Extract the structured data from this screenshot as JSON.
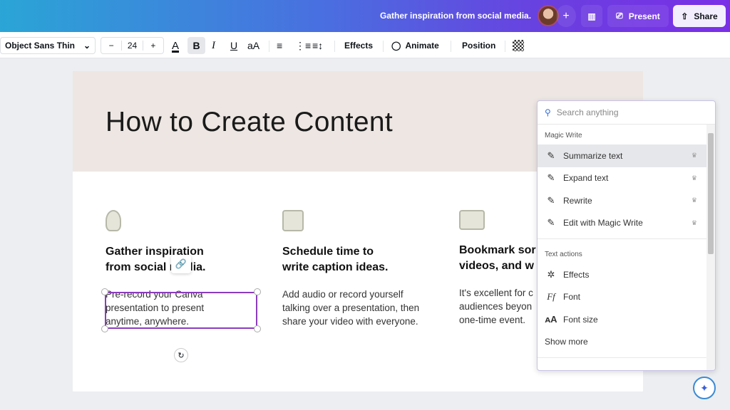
{
  "header": {
    "doc_title": "Gather inspiration from social media.",
    "add_label": "+",
    "present_label": "Present",
    "share_label": "Share"
  },
  "toolbar": {
    "font": "Object Sans Thin",
    "size": "24",
    "minus": "−",
    "plus": "+",
    "color": "A",
    "bold": "B",
    "italic": "I",
    "underline": "U",
    "case": "aA",
    "effects": "Effects",
    "animate": "Animate",
    "position": "Position"
  },
  "slide": {
    "title": "How to Create Content",
    "columns": [
      {
        "heading1": "Gather inspiration",
        "heading2": "from social media.",
        "body": [
          "Pre-record your Canva",
          "presentation to present",
          "anytime, anywhere."
        ]
      },
      {
        "heading1": "Schedule time to",
        "heading2": "write caption ideas.",
        "body": [
          "Add audio or record yourself",
          "talking over a presentation, then",
          "share your video with everyone."
        ]
      },
      {
        "heading1": "Bookmark sor",
        "heading2": "videos, and w",
        "body": [
          "It's excellent for c",
          "audiences beyon",
          "one-time event."
        ]
      }
    ]
  },
  "panel": {
    "search_placeholder": "Search anything",
    "magic_write_label": "Magic Write",
    "magic_items": [
      {
        "label": "Summarize text",
        "icon": "✎"
      },
      {
        "label": "Expand text",
        "icon": "✎"
      },
      {
        "label": "Rewrite",
        "icon": "✎"
      },
      {
        "label": "Edit with Magic Write",
        "icon": "✎"
      }
    ],
    "text_actions_label": "Text actions",
    "text_items": [
      {
        "label": "Effects",
        "icon": "✲"
      },
      {
        "label": "Font",
        "icon": "Ff"
      },
      {
        "label": "Font size",
        "icon": "ᴀA"
      }
    ],
    "show_more": "Show more"
  },
  "colors": {
    "accent": "#8b3dbd",
    "header_gradient_start": "#2aa5d6",
    "header_gradient_end": "#7a2fe6"
  }
}
